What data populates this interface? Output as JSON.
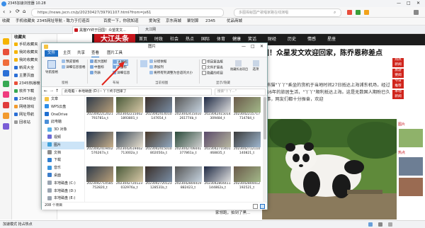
{
  "browser": {
    "title": "2345加速浏览器 10.28",
    "url": "https://news.jxcn.cn/p/20230427/39791107.html?from=jx61",
    "search_placeholder": "多图揭秘国产歌唱家路在线演唱",
    "bookmarks": [
      "收藏",
      "手机收藏夹",
      "2345网址导航",
      "翠竹",
      "2345网址导航 - 致力于打造百",
      "百度一下，你就知道",
      "爱淘宝",
      "京东商城",
      "聚划算",
      "2345",
      "优品商城",
      "游戏主播",
      "试试加载"
    ],
    "tabs": [
      "黑猫YY终于回国！众望发文...",
      "大江网"
    ],
    "status_text": "加速模式   抢占热点"
  },
  "sidebar": {
    "title": "收藏夹",
    "items": [
      "手机收藏夹",
      "我的收藏夹",
      "我的收藏夹",
      "新闻大全",
      "主要页面",
      "2345热播榜",
      "软件下载",
      "2345综合",
      "网络游戏",
      "网址导航",
      "回收站"
    ]
  },
  "news": {
    "logo": "大江头条",
    "nav": [
      "首页",
      "时政",
      "社会",
      "热点",
      "国际",
      "体育",
      "健康",
      "笑话",
      "财经",
      "历史",
      "情感",
      "星座"
    ],
    "headline": "国！众星发文欢迎回家，陈乔恩称差点",
    "article": "大熊猫\"丫丫\"乘坐的货机于当地时间27日抵达上海浦东机场，经过近16年的旅居生活，\"丫丫\"顺利抵达上海。这是无数国人期盼已久的事，网友们都十分振奋，欢迎",
    "red_tags": [
      "热点\n新闻",
      "旅游\n要闻",
      "今日\n推荐",
      "本地\n新闻"
    ],
    "snippet": "黑河新闻 上新！我国科学家领跑，拍到了黑...",
    "feed_labels": [
      "图片",
      "热点"
    ]
  },
  "explorer": {
    "title": "图片",
    "ribbon_tabs": [
      "文件",
      "主页",
      "共享",
      "查看",
      "图片工具"
    ],
    "panes": [
      "导航窗格",
      "预览窗格",
      "详细信息窗格"
    ],
    "layout": [
      "超大图标",
      "大图标",
      "中图标",
      "小图标",
      "列表",
      "详细信息"
    ],
    "current_view": [
      "分组依据",
      "添加列",
      "将所有列调整为合适的大小"
    ],
    "show_hide": [
      "项目复选框",
      "文件扩展名",
      "隐藏的项目",
      "隐藏所选项目",
      "选项"
    ],
    "groups": [
      "窗格",
      "布局",
      "当前视图",
      "显示/隐藏"
    ],
    "address": "此电脑 › 本地磁盘 (D:) › 丫丫终于回家了",
    "search_placeholder": "搜索\"丫丫...\"",
    "nav_items": [
      "文章",
      "WPS云盘",
      "OneDrive",
      "此电脑",
      "3D 对象",
      "视频",
      "图片",
      "文档",
      "下载",
      "音乐",
      "桌面",
      "本地磁盘 (C:)",
      "本地磁盘 (D:)",
      "本地磁盘 (E:)"
    ],
    "files": [
      "2023042212021793781a_t",
      "20230422150021893801_t",
      "2023042414010147654_t",
      "2023042415010261774b_t",
      "2023042415014309484_t",
      "2023042215717714784_t",
      "2023042419402576267a_t",
      "2023042619402713002a_t",
      "2023042415010802050a_t",
      "2023042706041377861a_t",
      "2023042710401468835_t",
      "2023042712110140821_t",
      "2023042714585752820_t",
      "2023042720123032976a_t",
      "2023042720123128531b_t",
      "2023042804419882423_t",
      "2023042804411144862a_t",
      "2023042804412192521_t"
    ],
    "status": "208 个项目"
  },
  "colors": {
    "brand_red": "#c8161d",
    "nav_dark": "#1c1c1c",
    "accent_blue": "#2b6fd6"
  }
}
